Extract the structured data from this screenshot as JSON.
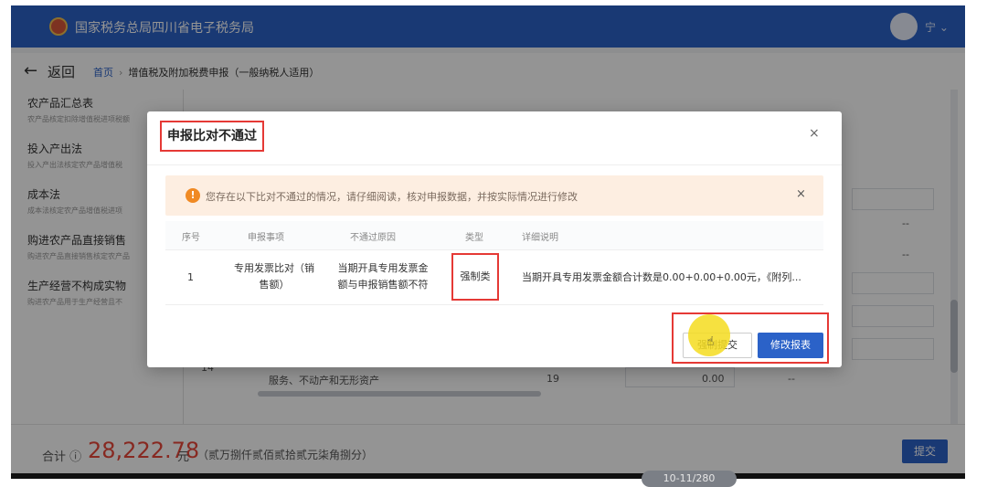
{
  "header": {
    "title": "国家税务总局四川省电子税务局",
    "user": "宁 ⌄"
  },
  "subbar": {
    "back_arrow": "←",
    "back_label": "返回",
    "breadcrumb_home": "首页",
    "breadcrumb_sep": "›",
    "breadcrumb_current": "增值税及附加税费申报（一般纳税人适用）"
  },
  "left_list": [
    {
      "title": "农产品汇总表",
      "sub": "农产品核定扣除增值税进项税额"
    },
    {
      "title": "投入产出法",
      "sub": "投入产出法核定农产品增值税"
    },
    {
      "title": "成本法",
      "sub": "成本法核定农产品增值税进项"
    },
    {
      "title": "购进农产品直接销售",
      "sub": "购进农产品直接销售核定农产品"
    },
    {
      "title": "生产经营不构成实物",
      "sub": "购进农产品用于生产经营且不"
    }
  ],
  "background_table": {
    "row_num": "14",
    "row_desc": "服务、不动产和无形资产",
    "row_col": "19",
    "row_value": "0.00",
    "row_dash": "--",
    "dash_a": "--",
    "dash_b": "--"
  },
  "footer": {
    "label": "合计 ⓘ",
    "amount": "28,222.78",
    "unit": "元",
    "amount_words": "（贰万捌仟贰佰贰拾贰元柒角捌分）",
    "submit": "提交"
  },
  "modal": {
    "title": "申报比对不通过",
    "close": "×",
    "alert": {
      "icon": "!",
      "text": "您存在以下比对不通过的情况，请仔细阅读，核对申报数据，并按实际情况进行修改",
      "close": "×"
    },
    "table": {
      "headers": [
        "序号",
        "申报事项",
        "不通过原因",
        "类型",
        "详细说明"
      ],
      "rows": [
        {
          "seq": "1",
          "item_line1": "专用发票比对（销",
          "item_line2": "售额）",
          "reason_line1": "当期开具专用发票金",
          "reason_line2": "额与申报销售额不符",
          "type": "强制类",
          "detail": "当期开具专用发票金额合计数是0.00+0.00+0.00元，《附列..."
        }
      ]
    },
    "buttons": {
      "force_submit": "强制提交",
      "edit_report": "修改报表"
    }
  },
  "page_indicator": "10-11/280",
  "colors": {
    "brand_blue": "#2b62c8",
    "alert_bg": "#fdeee1",
    "alert_icon": "#f08a24",
    "highlight_red": "#e53935",
    "amount_red": "#e8473a"
  }
}
